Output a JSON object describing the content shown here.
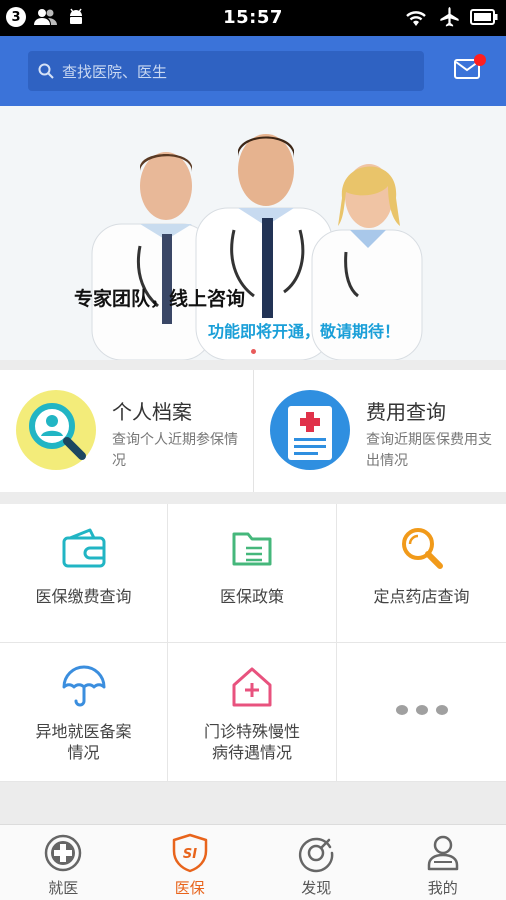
{
  "status_bar": {
    "notification_count": "3",
    "time": "15:57"
  },
  "search": {
    "placeholder": "查找医院、医生"
  },
  "banner": {
    "title": "专家团队，线上咨询",
    "subtitle": "功能即将开通，敬请期待！"
  },
  "record_cards": [
    {
      "title": "个人档案",
      "desc": "查询个人近期参保情况",
      "icon": "profile-search-icon"
    },
    {
      "title": "费用查询",
      "desc": "查询近期医保费用支出情况",
      "icon": "medical-bill-icon"
    }
  ],
  "grid": [
    {
      "label": "医保缴费查询",
      "icon": "wallet-icon"
    },
    {
      "label": "医保政策",
      "icon": "folder-icon"
    },
    {
      "label": "定点药店查询",
      "icon": "magnifier-icon"
    },
    {
      "label": "异地就医备案\n情况",
      "icon": "umbrella-icon"
    },
    {
      "label": "门诊特殊慢性\n病待遇情况",
      "icon": "clinic-house-icon"
    },
    {
      "label": "",
      "icon": "more-dots-icon"
    }
  ],
  "tabs": [
    {
      "label": "就医",
      "icon": "medical-cross-icon",
      "active": false
    },
    {
      "label": "医保",
      "icon": "si-shield-icon",
      "active": true
    },
    {
      "label": "发现",
      "icon": "discover-icon",
      "active": false
    },
    {
      "label": "我的",
      "icon": "person-icon",
      "active": false
    }
  ],
  "colors": {
    "primary": "#3b73d9",
    "active_tab": "#e8641c",
    "teal": "#21b5c4",
    "orange": "#f19a1a"
  }
}
